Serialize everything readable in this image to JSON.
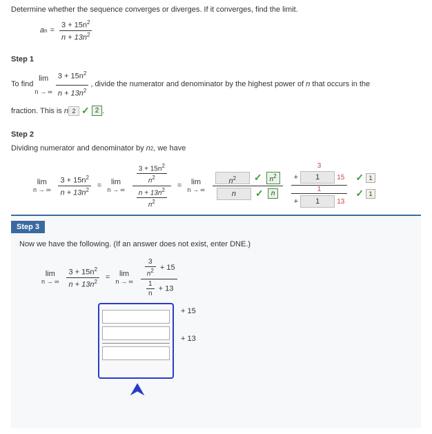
{
  "problem": {
    "statement": "Determine whether the sequence converges or diverges. If it converges, find the limit.",
    "seq_label": "a",
    "seq_sub": "n",
    "numerator": "3 + 15n",
    "denominator": "n + 13n"
  },
  "step1": {
    "heading": "Step 1",
    "text_before": "To find",
    "lim": "lim",
    "lim_approach": "n → ∞",
    "numerator": "3 + 15n",
    "denominator": "n + 13n",
    "text_mid": ", divide the numerator and denominator by the highest power of",
    "var": "n",
    "text_after1": "that occurs in the",
    "text_after2": "fraction. This is",
    "base": "n",
    "power_answer": "2",
    "power_hint": "2"
  },
  "step2": {
    "heading": "Step 2",
    "text": "Dividing numerator and denominator by",
    "by": "n",
    "exp": "2",
    "text_after": ", we have",
    "lim": "lim",
    "lim_approach": "n → ∞",
    "num1": "3 + 15n",
    "den1": "n + 13n",
    "num2": "3 + 15n",
    "den2": "n + 13n",
    "inner_div": "n",
    "answers": {
      "num_box_label": "n",
      "num_box_exp": "2",
      "num_hint": "n",
      "num_hint_exp": "2",
      "den_box_label": "n",
      "den_hint": "n",
      "r1": "3",
      "r2": "1",
      "r3": "15",
      "r4": "13",
      "r5": "1",
      "one_a": "1",
      "one_b": "1"
    }
  },
  "step3": {
    "heading": "Step 3",
    "text": "Now we have the following. (If an answer does not exist, enter DNE.)",
    "lim": "lim",
    "lim_approach": "n → ∞",
    "num1": "3 + 15n",
    "den1": "n + 13n",
    "frac_a_top": "3",
    "frac_a_bot": "n",
    "plus15": "+ 15",
    "frac_b_top": "1",
    "frac_b_bot": "n",
    "plus13": "+ 13",
    "side_15": "+ 15",
    "side_13": "+ 13"
  }
}
